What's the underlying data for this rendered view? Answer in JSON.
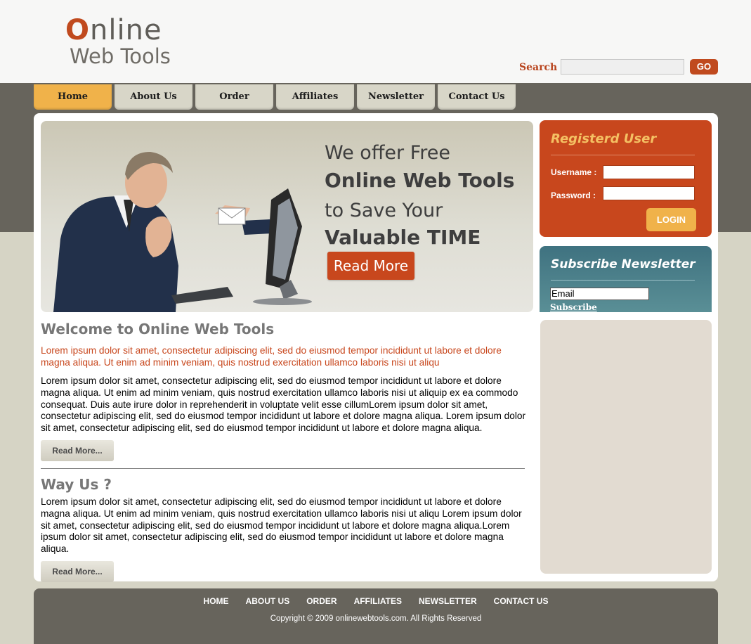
{
  "logo": {
    "first_letter": "O",
    "rest_line1": "nline",
    "line2": "Web Tools"
  },
  "search": {
    "label": "Search",
    "value": "",
    "go_label": "GO"
  },
  "nav": {
    "items": [
      "Home",
      "About Us",
      "Order",
      "Affiliates",
      "Newsletter",
      "Contact Us"
    ],
    "active": "Home"
  },
  "banner": {
    "line1": "We offer Free",
    "line2": "Online Web Tools",
    "line3": "to Save Your",
    "line4": "Valuable TIME",
    "button_label": "Read More"
  },
  "login": {
    "title": "Registerd User",
    "username_label": "Username :",
    "password_label": "Password :",
    "username_value": "",
    "password_value": "",
    "button_label": "LOGIN"
  },
  "newsletter": {
    "title": "Subscribe Newsletter",
    "email_value": "Email",
    "subscribe_label": "Subscribe"
  },
  "welcome": {
    "title": "Welcome to Online Web Tools",
    "lead": "Lorem ipsum dolor sit amet, consectetur adipiscing elit, sed do eiusmod tempor incididunt ut labore et dolore magna aliqua. Ut enim ad minim veniam, quis nostrud exercitation ullamco laboris nisi ut aliqu",
    "body": "Lorem ipsum dolor sit amet, consectetur adipiscing elit, sed do eiusmod tempor incididunt ut labore et dolore magna aliqua. Ut enim ad minim veniam, quis nostrud exercitation ullamco laboris nisi ut aliquip ex ea commodo consequat. Duis aute irure dolor in reprehenderit in voluptate velit esse cillumLorem ipsum dolor sit amet, consectetur adipiscing elit, sed do eiusmod tempor incididunt ut labore et dolore magna aliqua. Lorem ipsum dolor sit amet, consectetur adipiscing elit, sed do eiusmod tempor incididunt ut labore et dolore magna aliqua.",
    "read_more": "Read More..."
  },
  "why": {
    "title": "Way Us ?",
    "body": "Lorem ipsum dolor sit amet, consectetur adipiscing elit, sed do eiusmod tempor incididunt ut labore et dolore magna aliqua. Ut enim ad minim veniam, quis nostrud exercitation ullamco laboris nisi ut aliqu Lorem ipsum dolor sit amet, consectetur adipiscing elit, sed do eiusmod tempor incididunt ut labore et dolore magna aliqua.Lorem ipsum dolor sit amet, consectetur adipiscing elit, sed do eiusmod tempor incididunt ut labore et dolore magna aliqua.",
    "read_more": "Read More..."
  },
  "footer": {
    "links": [
      "HOME",
      "ABOUT US",
      "ORDER",
      "AFFILIATES",
      "NEWSLETTER",
      "CONTACT US"
    ],
    "copyright": "Copyright © 2009 onlinewebtools.com. All Rights Reserved"
  },
  "colors": {
    "accent_red": "#c8471d",
    "accent_orange": "#f0b24a",
    "dark_band": "#67645c",
    "teal": "#4b7f8a",
    "page_bg": "#d6d4c5"
  }
}
